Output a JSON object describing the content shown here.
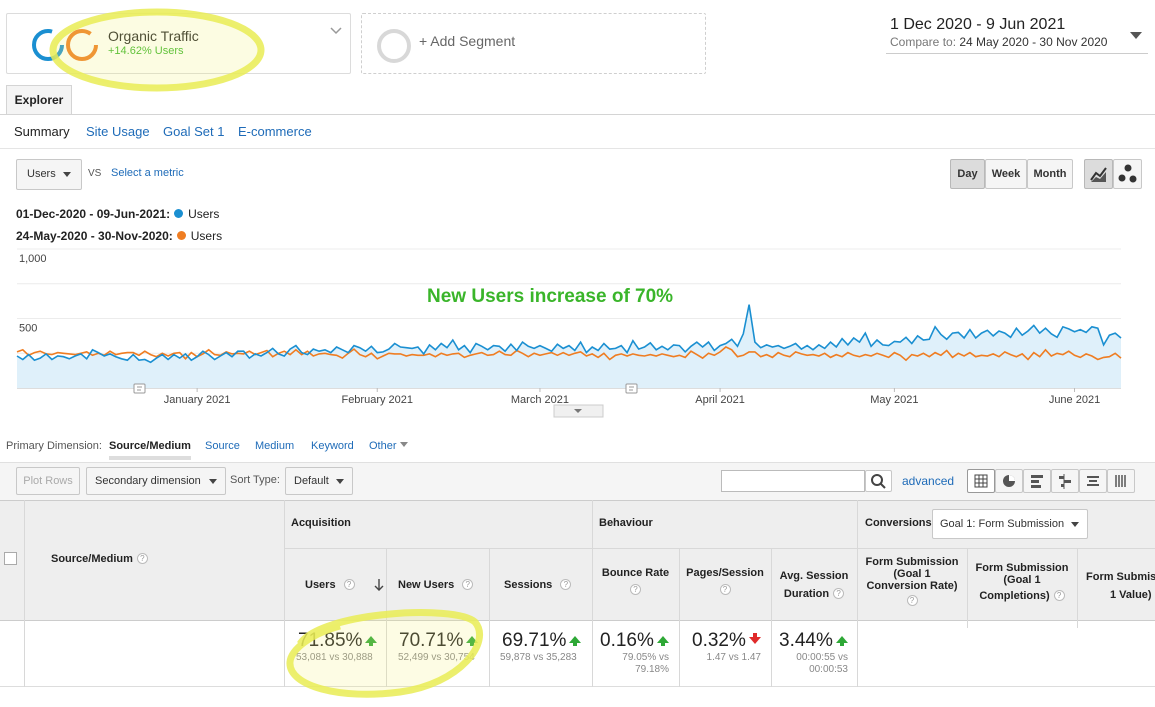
{
  "segments": {
    "active": {
      "name": "Organic Traffic",
      "delta": "+14.62% Users"
    },
    "add_label": "+ Add Segment"
  },
  "date_range": {
    "primary": "1 Dec 2020 - 9 Jun 2021",
    "compare_prefix": "Compare to:",
    "compare_range": "24 May 2020 - 30 Nov 2020"
  },
  "tabs": {
    "explorer": "Explorer"
  },
  "subnav": {
    "summary": "Summary",
    "site_usage": "Site Usage",
    "goal_set": "Goal Set 1",
    "ecommerce": "E-commerce"
  },
  "metric_picker": {
    "metric": "Users",
    "vs": "VS",
    "select": "Select a metric"
  },
  "granularity": {
    "day": "Day",
    "week": "Week",
    "month": "Month",
    "selected": "Day"
  },
  "chart_legend": {
    "current_range": "01-Dec-2020 - 09-Jun-2021:",
    "current_metric": "Users",
    "compare_range": "24-May-2020 - 30-Nov-2020:",
    "compare_metric": "Users"
  },
  "annotation": "New Users increase of 70%",
  "colors": {
    "current": "#1a8fd1",
    "compare": "#ef7d22",
    "area": "#dff0fa",
    "green": "#3ab52a",
    "link": "#1e6bb8"
  },
  "chart_data": {
    "type": "line",
    "ytick_labels": [
      "1,000",
      "500"
    ],
    "ylim": [
      0,
      1000
    ],
    "month_labels": [
      "January 2021",
      "February 2021",
      "March 2021",
      "April 2021",
      "May 2021",
      "June 2021"
    ],
    "series": [
      {
        "name": "Users",
        "color": "#1a8fd1",
        "area": true,
        "values": [
          230,
          205,
          240,
          200,
          215,
          245,
          205,
          230,
          225,
          210,
          230,
          245,
          210,
          275,
          255,
          230,
          245,
          225,
          210,
          200,
          240,
          200,
          205,
          185,
          215,
          240,
          205,
          240,
          215,
          245,
          200,
          225,
          265,
          240,
          205,
          230,
          255,
          225,
          265,
          265,
          215,
          245,
          230,
          255,
          285,
          245,
          230,
          280,
          305,
          255,
          240,
          280,
          265,
          275,
          255,
          295,
          275,
          255,
          305,
          290,
          265,
          300,
          255,
          260,
          280,
          320,
          295,
          290,
          285,
          295,
          245,
          310,
          275,
          320,
          290,
          345,
          275,
          305,
          255,
          320,
          300,
          275,
          305,
          300,
          265,
          315,
          270,
          330,
          300,
          285,
          305,
          285,
          265,
          315,
          285,
          305,
          270,
          330,
          255,
          295,
          270,
          320,
          280,
          285,
          305,
          255,
          340,
          280,
          295,
          325,
          275,
          300,
          275,
          310,
          305,
          260,
          300,
          330,
          295,
          330,
          270,
          305,
          320,
          350,
          300,
          390,
          600,
          330,
          290,
          310,
          295,
          305,
          285,
          300,
          320,
          280,
          305,
          275,
          310,
          285,
          330,
          295,
          355,
          310,
          360,
          330,
          395,
          300,
          345,
          310,
          305,
          335,
          330,
          365,
          320,
          375,
          345,
          350,
          440,
          385,
          350,
          395,
          400,
          360,
          420,
          360,
          395,
          415,
          375,
          410,
          395,
          365,
          430,
          380,
          410,
          450,
          395,
          430,
          390,
          365,
          440,
          425,
          405,
          420,
          400,
          440,
          430,
          310,
          380,
          395,
          360
        ]
      },
      {
        "name": "Users",
        "color": "#ef7d22",
        "area": false,
        "values": [
          260,
          275,
          235,
          255,
          265,
          245,
          240,
          255,
          250,
          245,
          240,
          250,
          260,
          235,
          250,
          235,
          265,
          240,
          250,
          255,
          255,
          235,
          265,
          240,
          225,
          250,
          230,
          250,
          255,
          210,
          255,
          225,
          245,
          275,
          240,
          235,
          260,
          245,
          250,
          245,
          265,
          240,
          255,
          270,
          225,
          250,
          265,
          240,
          275,
          240,
          265,
          230,
          245,
          250,
          240,
          235,
          215,
          250,
          280,
          240,
          225,
          250,
          210,
          230,
          250,
          245,
          245,
          230,
          240,
          235,
          235,
          245,
          225,
          250,
          235,
          245,
          250,
          220,
          235,
          245,
          255,
          235,
          240,
          265,
          240,
          235,
          270,
          250,
          225,
          250,
          235,
          245,
          255,
          235,
          255,
          235,
          250,
          260,
          230,
          245,
          220,
          250,
          205,
          235,
          245,
          230,
          245,
          235,
          230,
          240,
          230,
          245,
          235,
          225,
          235,
          220,
          265,
          240,
          215,
          250,
          235,
          260,
          295,
          275,
          225,
          235,
          260,
          260,
          225,
          240,
          220,
          255,
          235,
          225,
          260,
          245,
          235,
          240,
          230,
          250,
          220,
          240,
          225,
          255,
          235,
          225,
          240,
          230,
          250,
          235,
          220,
          255,
          235,
          200,
          240,
          230,
          250,
          225,
          255,
          235,
          270,
          220,
          250,
          230,
          255,
          225,
          235,
          230,
          245,
          225,
          260,
          240,
          225,
          245,
          205,
          255,
          225,
          275,
          230,
          250,
          240,
          265,
          235,
          220,
          245,
          230,
          205,
          220,
          225,
          250,
          215
        ]
      }
    ]
  },
  "dimensions": {
    "label": "Primary Dimension:",
    "primary": "Source/Medium",
    "options": [
      "Source",
      "Medium",
      "Keyword",
      "Other"
    ]
  },
  "toolbar": {
    "plot_rows": "Plot Rows",
    "secondary": "Secondary dimension",
    "sort_label": "Sort Type:",
    "sort_value": "Default",
    "advanced": "advanced"
  },
  "table": {
    "dimension_header": "Source/Medium",
    "groups": {
      "acquisition": "Acquisition",
      "behaviour": "Behaviour",
      "conversions": "Conversions",
      "goal_select": "Goal 1: Form Submission"
    },
    "headers": {
      "users": "Users",
      "new_users": "New Users",
      "sessions": "Sessions",
      "bounce_rate": "Bounce Rate",
      "pages_session": "Pages/Session",
      "avg_session_1": "Avg. Session",
      "avg_session_2": "Duration",
      "conv_rate_1": "Form Submission",
      "conv_rate_2": "(Goal 1",
      "conv_rate_3": "Conversion Rate)",
      "completions_1": "Form Submission",
      "completions_2": "(Goal 1",
      "completions_3": "Completions)",
      "value_1": "Form Submiss",
      "value_2": "1 Value)"
    },
    "totals": {
      "users": {
        "pct": "71.85%",
        "detail": "53,081 vs 30,888",
        "trend": "up"
      },
      "new_users": {
        "pct": "70.71%",
        "detail": "52,499 vs 30,754",
        "trend": "up"
      },
      "sessions": {
        "pct": "69.71%",
        "detail": "59,878 vs 35,283",
        "trend": "up"
      },
      "bounce_rate": {
        "pct": "0.16%",
        "detail_1": "79.05% vs",
        "detail_2": "79.18%",
        "trend": "up"
      },
      "pages_session": {
        "pct": "0.32%",
        "detail": "1.47 vs 1.47",
        "trend": "down"
      },
      "avg_session": {
        "pct": "3.44%",
        "detail_1": "00:00:55 vs",
        "detail_2": "00:00:53",
        "trend": "up"
      }
    }
  }
}
